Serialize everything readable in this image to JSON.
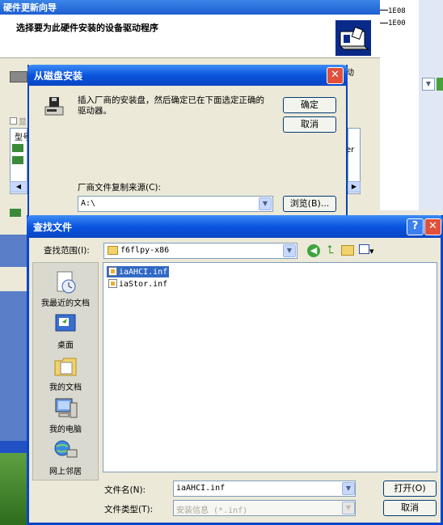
{
  "wizard": {
    "title": "硬件更新向导",
    "heading": "选择要为此硬件安装的设备驱动程序",
    "partial_labels": [
      "型号",
      "显",
      "动",
      "er"
    ]
  },
  "background": {
    "hex_labels": [
      "1E08",
      "1E00"
    ]
  },
  "install_from_disk": {
    "title": "从磁盘安装",
    "close_label": "✕",
    "message": "插入厂商的安装盘，然后确定已在下面选定正确的驱动器。",
    "ok_label": "确定",
    "cancel_label": "取消",
    "copy_from_label": "厂商文件复制来源(C):",
    "copy_from_value": "A:\\",
    "browse_label": "浏览(B)..."
  },
  "find_file": {
    "title": "查找文件",
    "help_label": "?",
    "close_label": "✕",
    "look_in_label": "查找范围(I):",
    "look_in_value": "f6flpy-x86",
    "places": [
      {
        "label": "我最近的文档",
        "icon": "recent-documents-icon"
      },
      {
        "label": "桌面",
        "icon": "desktop-icon"
      },
      {
        "label": "我的文档",
        "icon": "my-documents-icon"
      },
      {
        "label": "我的电脑",
        "icon": "my-computer-icon"
      },
      {
        "label": "网上邻居",
        "icon": "network-places-icon"
      }
    ],
    "files": [
      {
        "name": "iaAHCI.inf",
        "selected": true
      },
      {
        "name": "iaStor.inf",
        "selected": false
      }
    ],
    "file_name_label": "文件名(N):",
    "file_name_value": "iaAHCI.inf",
    "file_type_label": "文件类型(T):",
    "file_type_value": "安装信息 (*.inf)",
    "open_label": "打开(O)",
    "cancel_label": "取消"
  }
}
